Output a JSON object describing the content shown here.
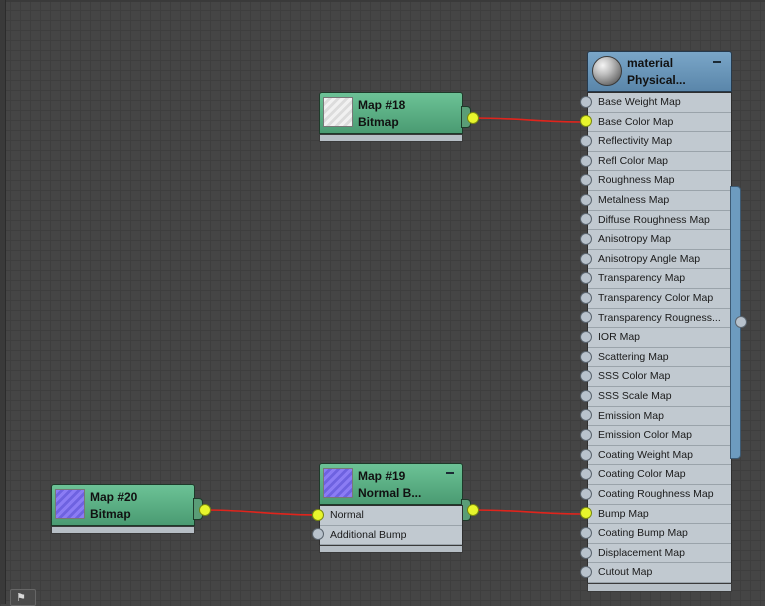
{
  "nodes": {
    "map18": {
      "name": "Map #18",
      "type": "Bitmap"
    },
    "map20": {
      "name": "Map #20",
      "type": "Bitmap"
    },
    "map19": {
      "name": "Map #19",
      "type": "Normal  B...",
      "slots": [
        "Normal",
        "Additional Bump"
      ]
    },
    "material": {
      "name": "material",
      "type": "Physical...",
      "slots": [
        "Base Weight Map",
        "Base Color Map",
        "Reflectivity Map",
        "Refl Color Map",
        "Roughness Map",
        "Metalness Map",
        "Diffuse Roughness Map",
        "Anisotropy Map",
        "Anisotropy Angle Map",
        "Transparency Map",
        "Transparency Color Map",
        "Transparency  Rougness...",
        "IOR Map",
        "Scattering Map",
        "SSS Color Map",
        "SSS Scale Map",
        "Emission Map",
        "Emission Color Map",
        "Coating Weight Map",
        "Coating Color Map",
        "Coating Roughness Map",
        "Bump Map",
        "Coating Bump Map",
        "Displacement Map",
        "Cutout Map"
      ],
      "connected_slots": [
        "Base Color Map",
        "Bump Map"
      ]
    }
  },
  "colors": {
    "canvas": "#454545",
    "wire": "#e0241c",
    "socket_active": "#e7f52c",
    "map_header": "#5aa981",
    "material_header": "#6d97bb"
  },
  "icons": {
    "thumb_map18": "bitmap-white-thumbnail",
    "thumb_map20": "bitmap-purple-thumbnail",
    "thumb_map19": "normal-bump-purple-thumbnail",
    "thumb_material": "material-sphere-thumbnail",
    "navigator": "navigator-icon"
  }
}
